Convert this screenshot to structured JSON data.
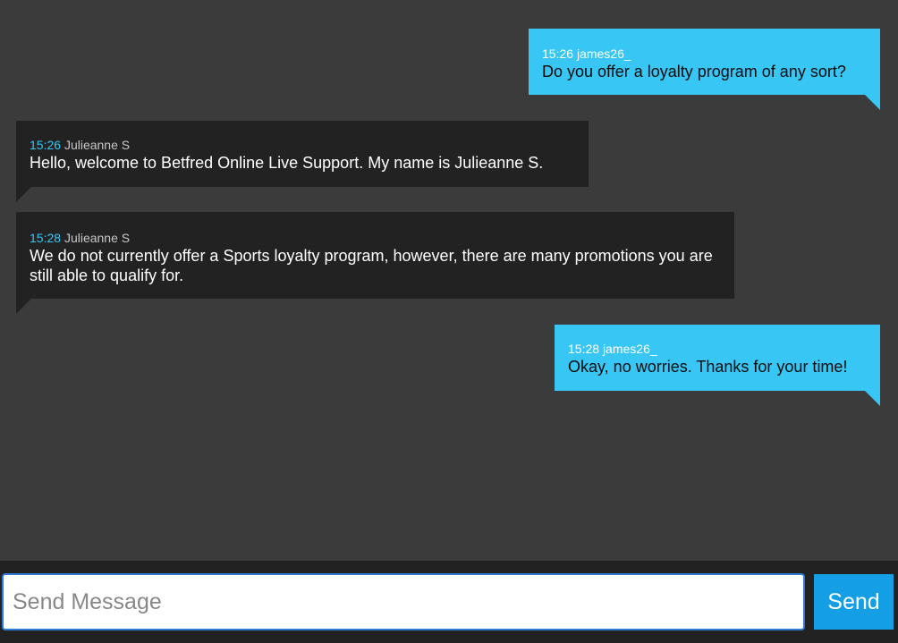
{
  "messages": [
    {
      "direction": "outgoing",
      "time": "15:26",
      "author": "james26_",
      "text": "Do you offer a loyalty program of any sort?"
    },
    {
      "direction": "incoming",
      "time": "15:26",
      "author": "Julieanne S",
      "text": "Hello, welcome to Betfred Online Live Support. My name is Julieanne S."
    },
    {
      "direction": "incoming",
      "time": "15:28",
      "author": "Julieanne S",
      "text": "We do not currently offer a Sports loyalty program, however, there are many promotions you are still able to qualify for."
    },
    {
      "direction": "outgoing",
      "time": "15:28",
      "author": "james26_",
      "text": "Okay, no worries. Thanks for your time!"
    }
  ],
  "composer": {
    "placeholder": "Send Message",
    "value": "",
    "send_label": "Send"
  },
  "colors": {
    "background": "#3b3b3b",
    "outgoing_bubble": "#38c6f4",
    "incoming_bubble": "#222222",
    "accent_time": "#38c6f4",
    "send_button": "#149ee4",
    "input_border": "#2e7bd6"
  }
}
